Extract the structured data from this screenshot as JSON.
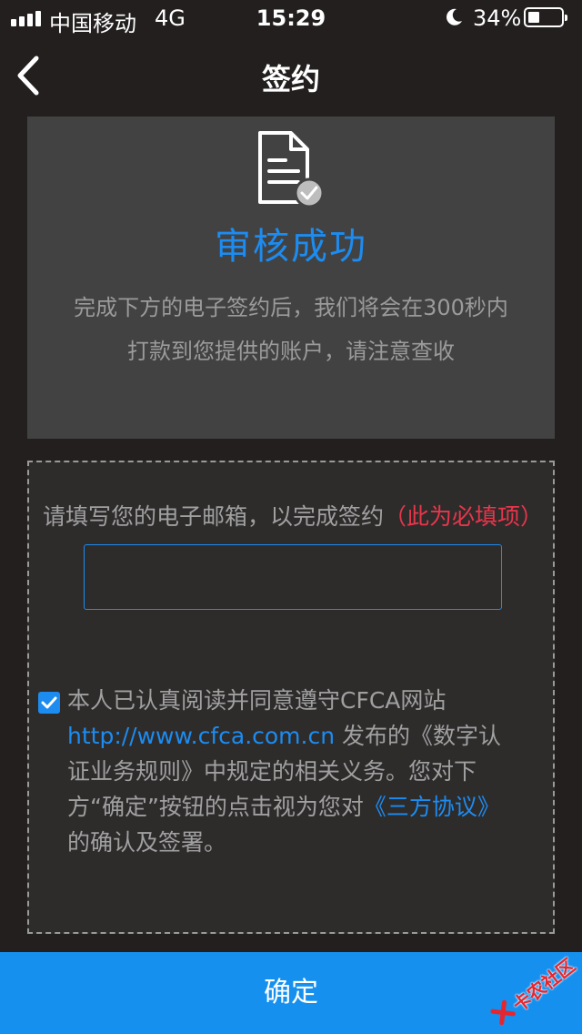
{
  "status_bar": {
    "carrier": "中国移动",
    "network": "4G",
    "time": "15:29",
    "battery": "34%",
    "battery_level": 0.34
  },
  "nav": {
    "title": "签约",
    "back_icon": "chevron-left-icon"
  },
  "success": {
    "icon": "document-check-icon",
    "title": "审核成功",
    "description_line1": "完成下方的电子签约后，我们将会在300秒内",
    "description_line2": "打款到您提供的账户，请注意查收"
  },
  "form": {
    "email_prompt": "请填写您的电子邮箱，以完成签约",
    "required_note": "（此为必填项）",
    "email_value": "",
    "agreement": {
      "checked": true,
      "text_part1": "本人已认真阅读并同意遵守CFCA网站",
      "link_url": "http://www.cfca.com.cn",
      "text_part2": " 发布的《数字认证业务规则》中规定的相关义务。您对下方“确定”按钮的点击视为您对",
      "link_agreement": "《三方协议》",
      "text_part3": "的确认及签署。"
    }
  },
  "confirm_button": "确定",
  "watermark": "卡农社区",
  "colors": {
    "background": "#231f1f",
    "card": "#434242",
    "accent": "#1c8cf1",
    "required": "#e8364b",
    "button": "#1590ef"
  }
}
